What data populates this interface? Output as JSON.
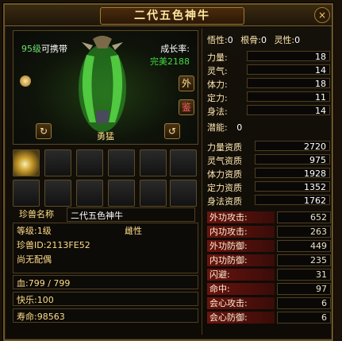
{
  "window": {
    "title": "二代五色神牛",
    "close_label": "×"
  },
  "attributes_top": {
    "wuxing_label": "悟性:",
    "wuxing_value": "0",
    "genggu_label": "根骨:",
    "genggu_value": "0",
    "lingxing_label": "灵性:",
    "lingxing_value": "0"
  },
  "portrait": {
    "level_value": "95",
    "level_suffix": "级",
    "carry_label": "可携带",
    "growth_label": "成长率:",
    "growth_value": "完美2188",
    "btn_wai": "外",
    "btn_jian": "鉴",
    "nature": "勇猛",
    "rotate_left": "↻",
    "rotate_right": "↺"
  },
  "slots": [
    {
      "filled": true
    },
    {
      "filled": false
    },
    {
      "filled": false
    },
    {
      "filled": false
    },
    {
      "filled": false
    },
    {
      "filled": false
    },
    {
      "filled": false
    },
    {
      "filled": false
    },
    {
      "filled": false
    },
    {
      "filled": false
    },
    {
      "filled": false
    },
    {
      "filled": false
    }
  ],
  "info": {
    "name_label": "珍兽名称",
    "name_value": "二代五色神牛",
    "grade": "等级:1级",
    "gender": "雌性",
    "pet_id": "珍兽ID:2113FE52",
    "spouse": "尚无配偶",
    "hp": "血:799 / 799",
    "happiness": "快乐:100",
    "life": "寿命:98563"
  },
  "basic_stats": [
    {
      "label": "力量:",
      "value": "18"
    },
    {
      "label": "灵气:",
      "value": "14"
    },
    {
      "label": "体力:",
      "value": "18"
    },
    {
      "label": "定力:",
      "value": "11"
    },
    {
      "label": "身法:",
      "value": "14"
    }
  ],
  "potential": {
    "label": "潜能:",
    "value": "0"
  },
  "aptitude": [
    {
      "label": "力量资质",
      "value": "2720"
    },
    {
      "label": "灵气资质",
      "value": "975"
    },
    {
      "label": "体力资质",
      "value": "1928"
    },
    {
      "label": "定力资质",
      "value": "1352"
    },
    {
      "label": "身法资质",
      "value": "1762"
    }
  ],
  "combat": [
    {
      "label": "外功攻击:",
      "value": "652"
    },
    {
      "label": "内功攻击:",
      "value": "263"
    },
    {
      "label": "外功防御:",
      "value": "449"
    },
    {
      "label": "内功防御:",
      "value": "235"
    },
    {
      "label": "闪避:",
      "value": "31"
    },
    {
      "label": "命中:",
      "value": "97"
    },
    {
      "label": "会心攻击:",
      "value": "6"
    },
    {
      "label": "会心防御:",
      "value": "6"
    }
  ],
  "colors": {
    "gold": "#ffdd88",
    "green": "#43d843",
    "combat_label_bg": "#6a1410"
  }
}
